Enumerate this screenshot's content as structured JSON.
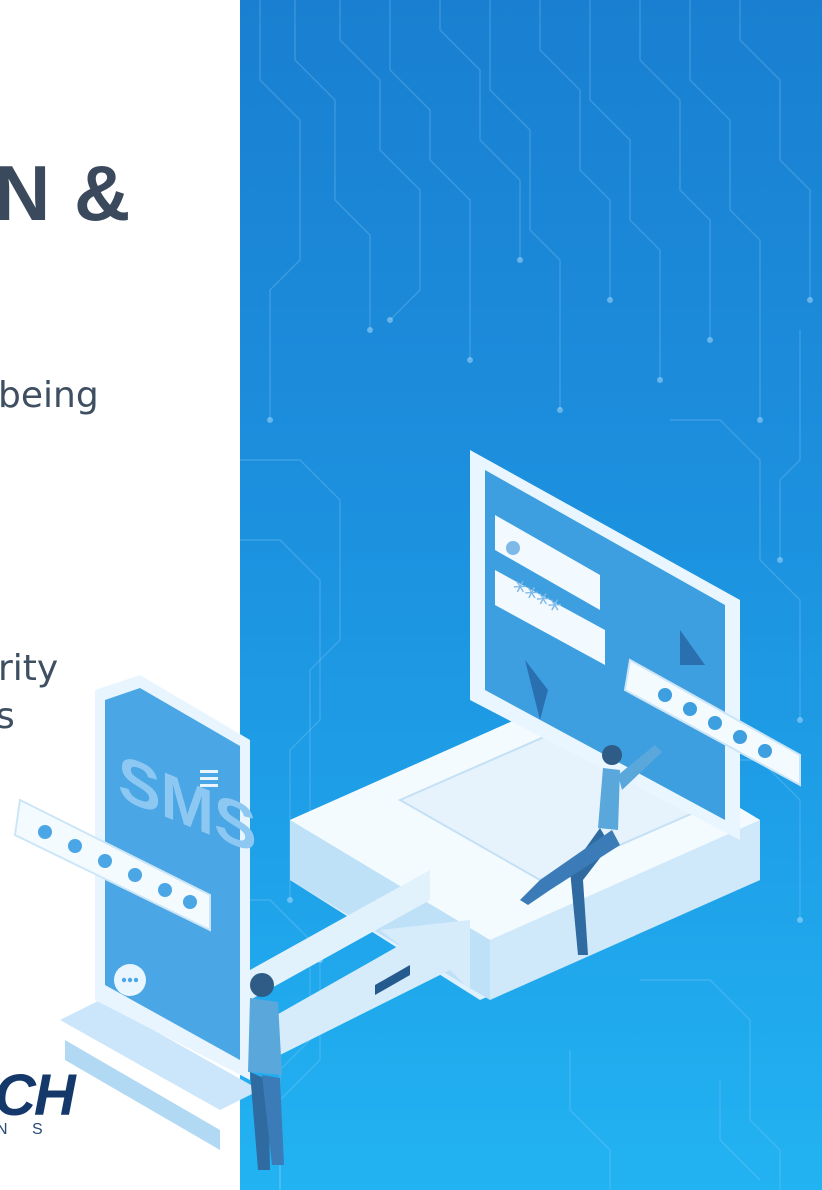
{
  "title_fragment": "N &",
  "body_fragments": [
    "being",
    "rity",
    "s"
  ],
  "logo": {
    "mark": "CH",
    "subtitle": "N S"
  },
  "illustration": {
    "phone_label": "SMS",
    "password_mask": "****",
    "icons": [
      "user-icon",
      "lock-icon",
      "chat-bubble-icon",
      "menu-icon",
      "arrow-icon"
    ]
  },
  "colors": {
    "background_blue": "#1c8fdd",
    "light_blue": "#22b3f2",
    "title_text": "#3a4a5c",
    "logo_navy": "#14386a"
  }
}
